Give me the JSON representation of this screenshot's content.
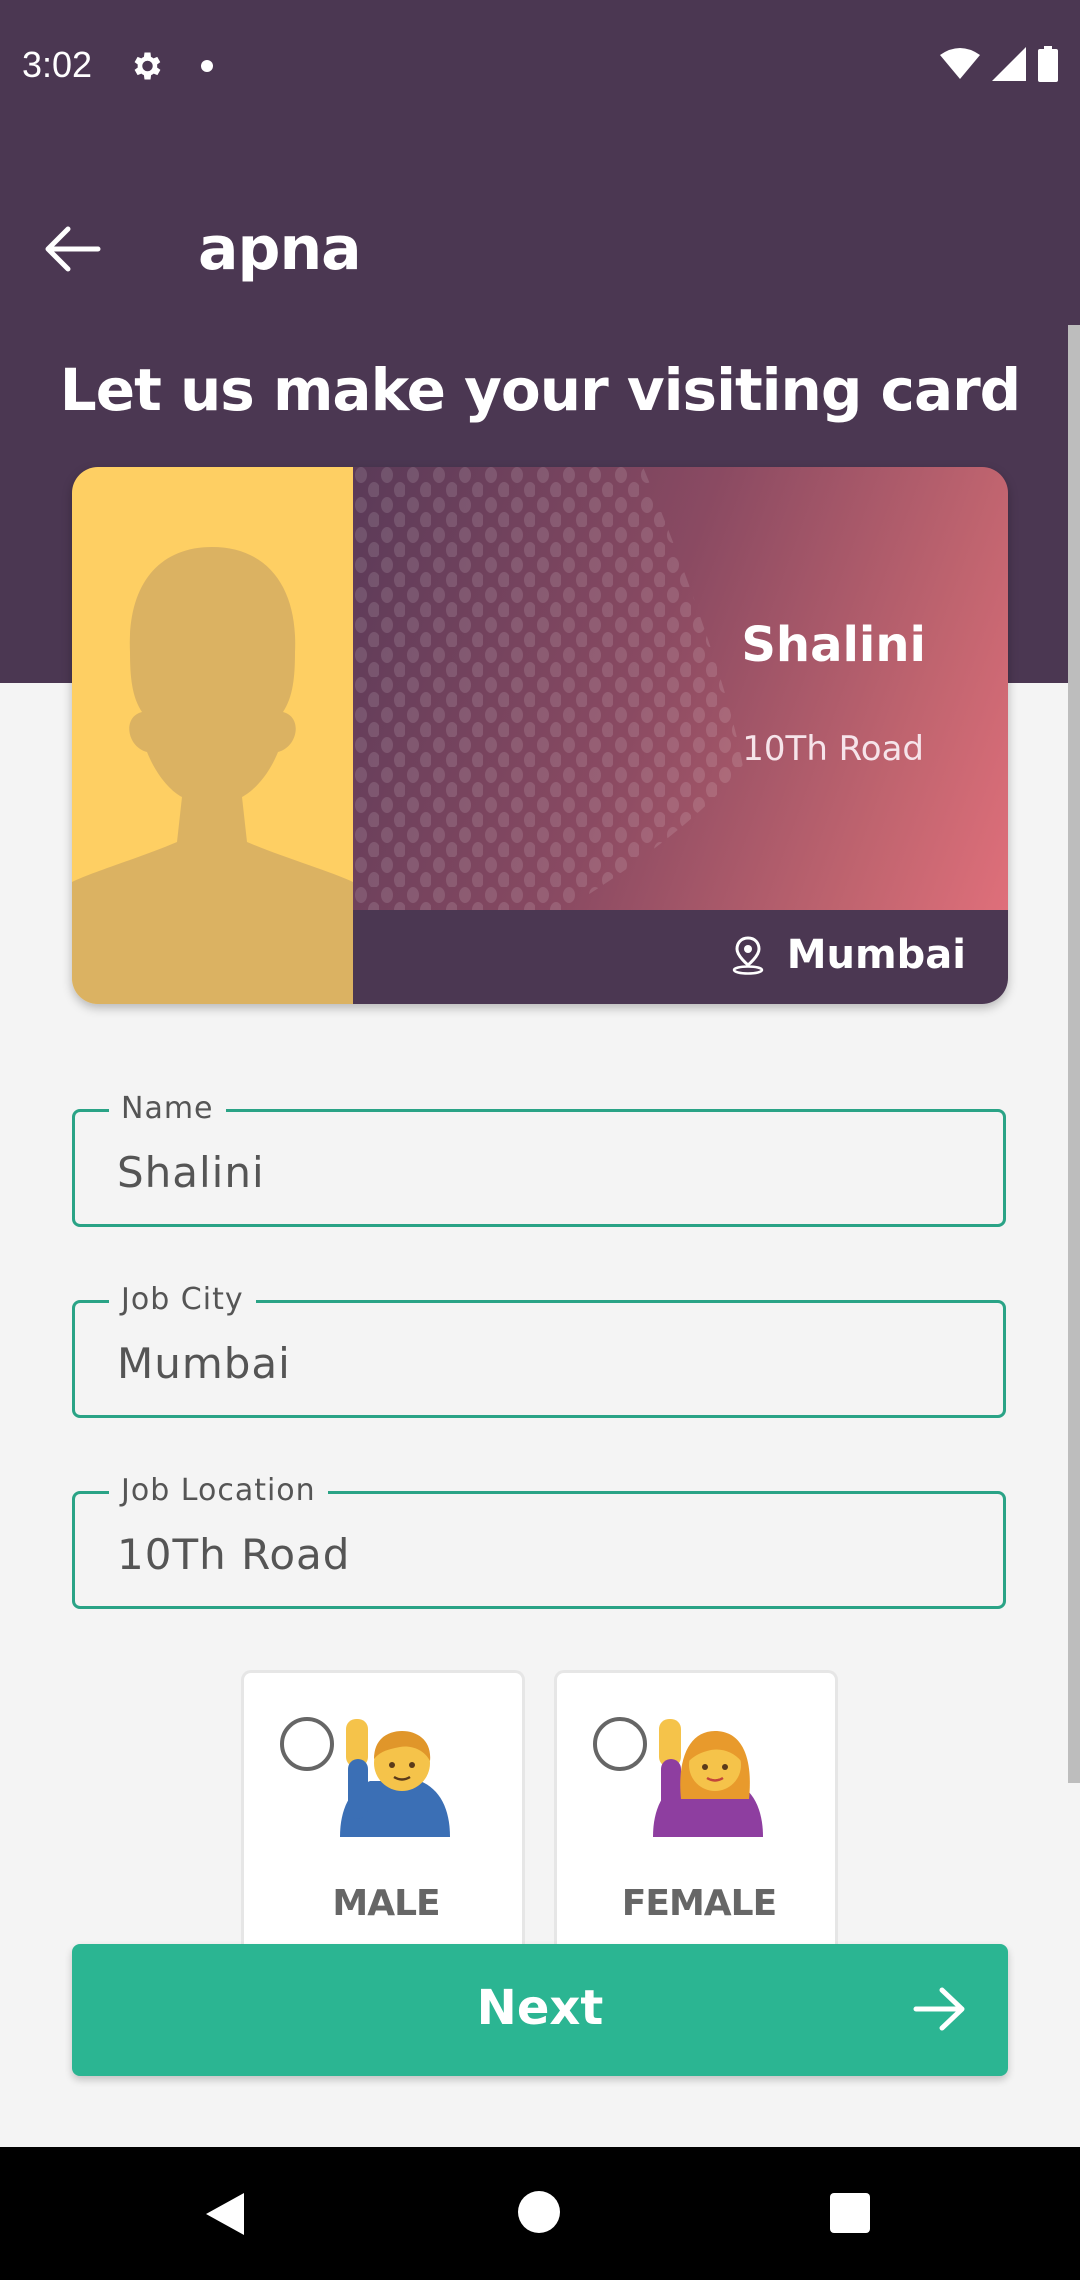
{
  "status_bar": {
    "time": "3:02",
    "icons": [
      "gear-icon",
      "notification-dot",
      "wifi-icon",
      "cell-signal-icon",
      "battery-icon"
    ]
  },
  "header": {
    "back_icon": "arrow-left-icon",
    "app_title": "apna"
  },
  "headline": "Let us make your visiting card",
  "visiting_card": {
    "name": "Shalini",
    "location": "10Th Road",
    "city": "Mumbai",
    "city_icon": "location-pin-icon",
    "photo_icon": "person-silhouette-icon"
  },
  "form": {
    "name": {
      "label": "Name",
      "value": "Shalini"
    },
    "job_city": {
      "label": "Job City",
      "value": "Mumbai"
    },
    "job_location": {
      "label": "Job Location",
      "value": "10Th Road"
    }
  },
  "gender": {
    "options": [
      {
        "label": "MALE",
        "icon": "man-raising-hand-emoji",
        "selected": false
      },
      {
        "label": "FEMALE",
        "icon": "woman-raising-hand-emoji",
        "selected": false
      }
    ]
  },
  "next_button": {
    "label": "Next",
    "icon": "arrow-right-icon"
  },
  "colors": {
    "header_bg": "#4b3752",
    "accent": "#2bb592",
    "field_border": "#2aa386",
    "photo_bg": "#fecf63",
    "card_gradient_end": "#df6f7a"
  },
  "nav_bar": {
    "icons": [
      "nav-back-icon",
      "nav-home-icon",
      "nav-recents-icon"
    ]
  }
}
